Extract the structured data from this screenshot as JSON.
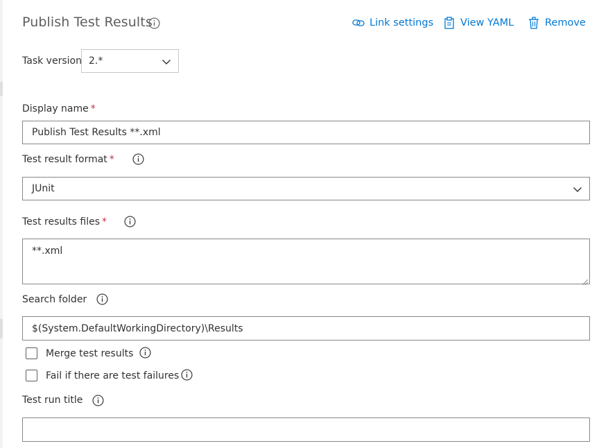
{
  "header": {
    "title": "Publish Test Results",
    "actions": {
      "link_settings": "Link settings",
      "view_yaml": "View YAML",
      "remove": "Remove"
    }
  },
  "task_version": {
    "label": "Task version",
    "value": "2.*"
  },
  "display_name": {
    "label": "Display name",
    "required_mark": "*",
    "value": "Publish Test Results **.xml"
  },
  "test_result_format": {
    "label": "Test result format",
    "required_mark": "*",
    "value": "JUnit"
  },
  "test_results_files": {
    "label": "Test results files",
    "required_mark": "*",
    "value": "**.xml"
  },
  "search_folder": {
    "label": "Search folder",
    "value": "$(System.DefaultWorkingDirectory)\\Results"
  },
  "merge_test_results": {
    "label": "Merge test results",
    "checked": false
  },
  "fail_on_failures": {
    "label": "Fail if there are test failures",
    "checked": false
  },
  "test_run_title": {
    "label": "Test run title",
    "value": ""
  },
  "colors": {
    "accent": "#0078d4",
    "required": "#c4314b",
    "title": "#605e5c",
    "border": "#8a8886"
  },
  "icons": {
    "info": "info-icon",
    "link": "link-icon",
    "yaml": "clipboard-icon",
    "remove": "trash-icon",
    "dropdown": "chevron-down-icon"
  }
}
